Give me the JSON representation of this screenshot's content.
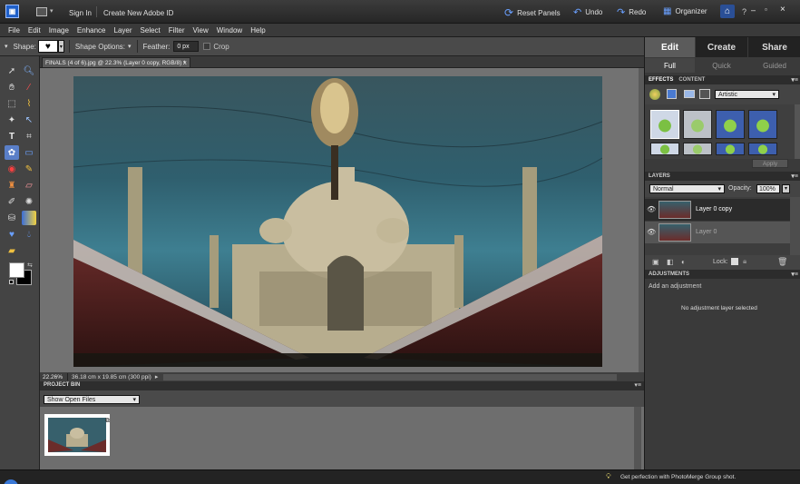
{
  "topbar": {
    "app_icon": "photoshop-elements-logo",
    "sign_in": "Sign In",
    "create_id": "Create New Adobe ID",
    "reset_panels": "Reset Panels",
    "undo": "Undo",
    "redo": "Redo",
    "organizer": "Organizer"
  },
  "menu": [
    "File",
    "Edit",
    "Image",
    "Enhance",
    "Layer",
    "Select",
    "Filter",
    "View",
    "Window",
    "Help"
  ],
  "options": {
    "shape_label": "Shape:",
    "shape_options": "Shape Options:",
    "feather_label": "Feather:",
    "feather_value": "0 px",
    "crop_label": "Crop"
  },
  "document": {
    "tab_title": "FINALS (4 of 6).jpg @ 22.3% (Layer 0 copy, RGB/8) *",
    "close": "×",
    "zoom": "22.26%",
    "size": "36.18 cm x 19.85 cm (300 ppi)"
  },
  "project_bin": {
    "header": "PROJECT BIN",
    "show_menu": "Show Open Files"
  },
  "right": {
    "tabs": [
      "Edit",
      "Create",
      "Share"
    ],
    "subtabs": [
      "Full",
      "Quick",
      "Guided"
    ],
    "effects_head": "EFFECTS",
    "content_head": "CONTENT",
    "effects_dropdown": "Artistic",
    "apply": "Apply",
    "layers_head": "LAYERS",
    "blend_mode": "Normal",
    "opacity_label": "Opacity:",
    "opacity_value": "100%",
    "layers": [
      {
        "name": "Layer 0 copy",
        "selected": true
      },
      {
        "name": "Layer 0",
        "selected": false
      }
    ],
    "lock_label": "Lock:",
    "adjust_head": "ADJUSTMENTS",
    "adjust_add": "Add an adjustment",
    "adjust_none": "No adjustment layer selected"
  },
  "status_tip": "Get perfection with PhotoMerge Group shot.",
  "colors": {
    "accent": "#3d6fd2",
    "panel": "#3a3a3a",
    "canvas_bg": "#727272"
  }
}
